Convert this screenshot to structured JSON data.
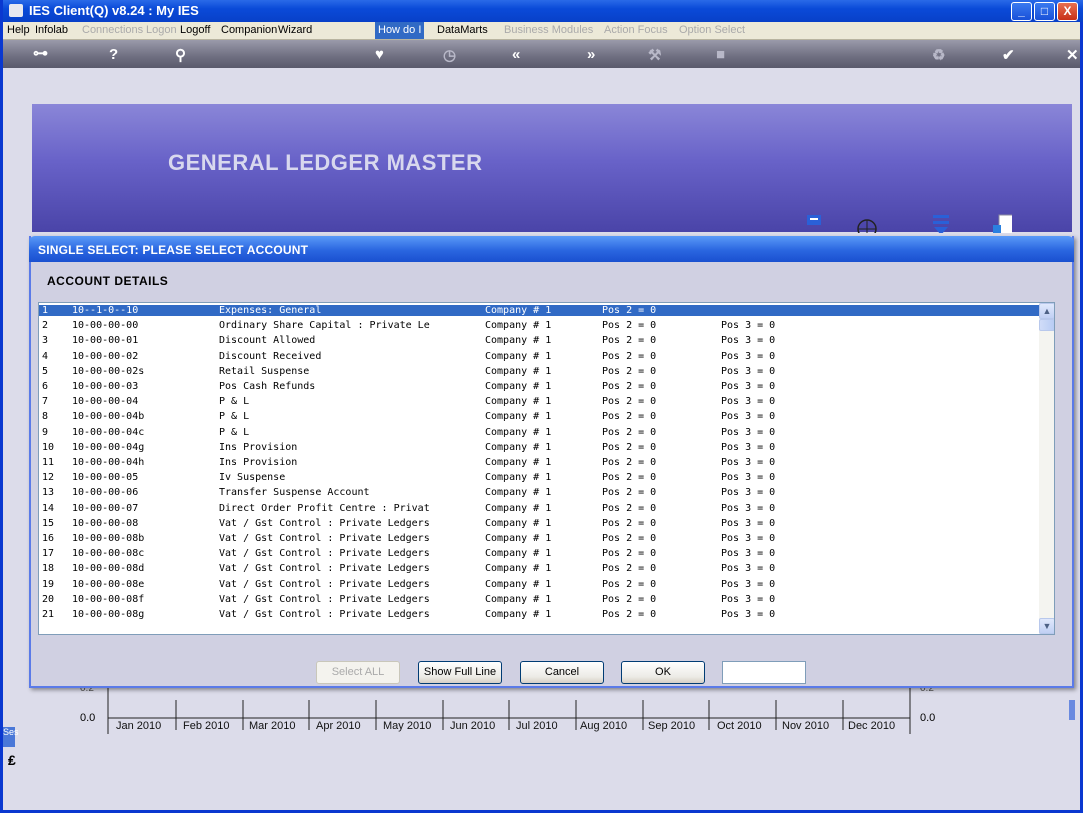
{
  "window": {
    "title": "IES Client(Q) v8.24 : My IES",
    "min_glyph": "_",
    "max_glyph": "□",
    "close_glyph": "X"
  },
  "menu": [
    {
      "label": "Help",
      "state": "enabled"
    },
    {
      "label": "Infolab",
      "state": "enabled"
    },
    {
      "label": "Connections",
      "state": "disabled"
    },
    {
      "label": "Logon",
      "state": "disabled"
    },
    {
      "label": "Logoff",
      "state": "enabled"
    },
    {
      "label": "Companion",
      "state": "enabled"
    },
    {
      "label": "Wizard",
      "state": "enabled"
    },
    {
      "label": "How do I",
      "state": "active"
    },
    {
      "label": "DataMarts",
      "state": "enabled"
    },
    {
      "label": "Business Modules",
      "state": "disabled"
    },
    {
      "label": "Action Focus",
      "state": "disabled"
    },
    {
      "label": "Option Select",
      "state": "disabled"
    }
  ],
  "toolbar_icons": [
    "key-icon",
    "help-icon",
    "search-icon",
    "heart-icon",
    "clock-icon",
    "back-icon",
    "forward-icon",
    "tools-icon",
    "stop-icon",
    "recycle-icon",
    "check-icon",
    "exit-icon"
  ],
  "banner": {
    "title": "GENERAL LEDGER MASTER"
  },
  "dialog": {
    "title": "SINGLE SELECT: PLEASE SELECT ACCOUNT",
    "section": "ACCOUNT DETAILS",
    "rows": [
      {
        "idx": "1",
        "code": "10--1-0--10",
        "desc": "Expenses: General",
        "company": "Company # 1",
        "pos2": "Pos 2 = 0",
        "pos3": ""
      },
      {
        "idx": "2",
        "code": "10-00-00-00",
        "desc": "Ordinary Share Capital : Private Le",
        "company": "Company # 1",
        "pos2": "Pos 2 = 0",
        "pos3": "Pos 3 = 0"
      },
      {
        "idx": "3",
        "code": "10-00-00-01",
        "desc": "Discount Allowed",
        "company": "Company # 1",
        "pos2": "Pos 2 = 0",
        "pos3": "Pos 3 = 0"
      },
      {
        "idx": "4",
        "code": "10-00-00-02",
        "desc": "Discount Received",
        "company": "Company # 1",
        "pos2": "Pos 2 = 0",
        "pos3": "Pos 3 = 0"
      },
      {
        "idx": "5",
        "code": "10-00-00-02s",
        "desc": "Retail Suspense",
        "company": "Company # 1",
        "pos2": "Pos 2 = 0",
        "pos3": "Pos 3 = 0"
      },
      {
        "idx": "6",
        "code": "10-00-00-03",
        "desc": "Pos Cash Refunds",
        "company": "Company # 1",
        "pos2": "Pos 2 = 0",
        "pos3": "Pos 3 = 0"
      },
      {
        "idx": "7",
        "code": "10-00-00-04",
        "desc": "P & L",
        "company": "Company # 1",
        "pos2": "Pos 2 = 0",
        "pos3": "Pos 3 = 0"
      },
      {
        "idx": "8",
        "code": "10-00-00-04b",
        "desc": "P & L",
        "company": "Company # 1",
        "pos2": "Pos 2 = 0",
        "pos3": "Pos 3 = 0"
      },
      {
        "idx": "9",
        "code": "10-00-00-04c",
        "desc": "P & L",
        "company": "Company # 1",
        "pos2": "Pos 2 = 0",
        "pos3": "Pos 3 = 0"
      },
      {
        "idx": "10",
        "code": "10-00-00-04g",
        "desc": "Ins Provision",
        "company": "Company # 1",
        "pos2": "Pos 2 = 0",
        "pos3": "Pos 3 = 0"
      },
      {
        "idx": "11",
        "code": "10-00-00-04h",
        "desc": "Ins Provision",
        "company": "Company # 1",
        "pos2": "Pos 2 = 0",
        "pos3": "Pos 3 = 0"
      },
      {
        "idx": "12",
        "code": "10-00-00-05",
        "desc": "Iv Suspense",
        "company": "Company # 1",
        "pos2": "Pos 2 = 0",
        "pos3": "Pos 3 = 0"
      },
      {
        "idx": "13",
        "code": "10-00-00-06",
        "desc": "Transfer Suspense Account",
        "company": "Company # 1",
        "pos2": "Pos 2 = 0",
        "pos3": "Pos 3 = 0"
      },
      {
        "idx": "14",
        "code": "10-00-00-07",
        "desc": "Direct Order Profit Centre : Privat",
        "company": "Company # 1",
        "pos2": "Pos 2 = 0",
        "pos3": "Pos 3 = 0"
      },
      {
        "idx": "15",
        "code": "10-00-00-08",
        "desc": "Vat / Gst Control : Private Ledgers",
        "company": "Company # 1",
        "pos2": "Pos 2 = 0",
        "pos3": "Pos 3 = 0"
      },
      {
        "idx": "16",
        "code": "10-00-00-08b",
        "desc": "Vat / Gst Control : Private Ledgers",
        "company": "Company # 1",
        "pos2": "Pos 2 = 0",
        "pos3": "Pos 3 = 0"
      },
      {
        "idx": "17",
        "code": "10-00-00-08c",
        "desc": "Vat / Gst Control : Private Ledgers",
        "company": "Company # 1",
        "pos2": "Pos 2 = 0",
        "pos3": "Pos 3 = 0"
      },
      {
        "idx": "18",
        "code": "10-00-00-08d",
        "desc": "Vat / Gst Control : Private Ledgers",
        "company": "Company # 1",
        "pos2": "Pos 2 = 0",
        "pos3": "Pos 3 = 0"
      },
      {
        "idx": "19",
        "code": "10-00-00-08e",
        "desc": "Vat / Gst Control : Private Ledgers",
        "company": "Company # 1",
        "pos2": "Pos 2 = 0",
        "pos3": "Pos 3 = 0"
      },
      {
        "idx": "20",
        "code": "10-00-00-08f",
        "desc": "Vat / Gst Control : Private Ledgers",
        "company": "Company # 1",
        "pos2": "Pos 2 = 0",
        "pos3": "Pos 3 = 0"
      },
      {
        "idx": "21",
        "code": "10-00-00-08g",
        "desc": "Vat / Gst Control : Private Ledgers",
        "company": "Company # 1",
        "pos2": "Pos 2 = 0",
        "pos3": "Pos 3 = 0"
      }
    ],
    "buttons": {
      "select_all": "Select ALL",
      "show_full_line": "Show Full Line",
      "cancel": "Cancel",
      "ok": "OK"
    },
    "text_box_value": ""
  },
  "background_chart": {
    "y_left": "0.0",
    "y_right": "0.0",
    "y_left_partial": "0.2",
    "y_right_partial": "0.2",
    "months": [
      "Jan 2010",
      "Feb 2010",
      "Mar 2010",
      "Apr 2010",
      "May 2010",
      "Jun 2010",
      "Jul 2010",
      "Aug 2010",
      "Sep 2010",
      "Oct 2010",
      "Nov 2010",
      "Dec 2010"
    ]
  },
  "side_tab": "Ses",
  "colors": {
    "accent": "#316ac5",
    "title_blue": "#0a4ad8",
    "banner": "#6862c8"
  }
}
